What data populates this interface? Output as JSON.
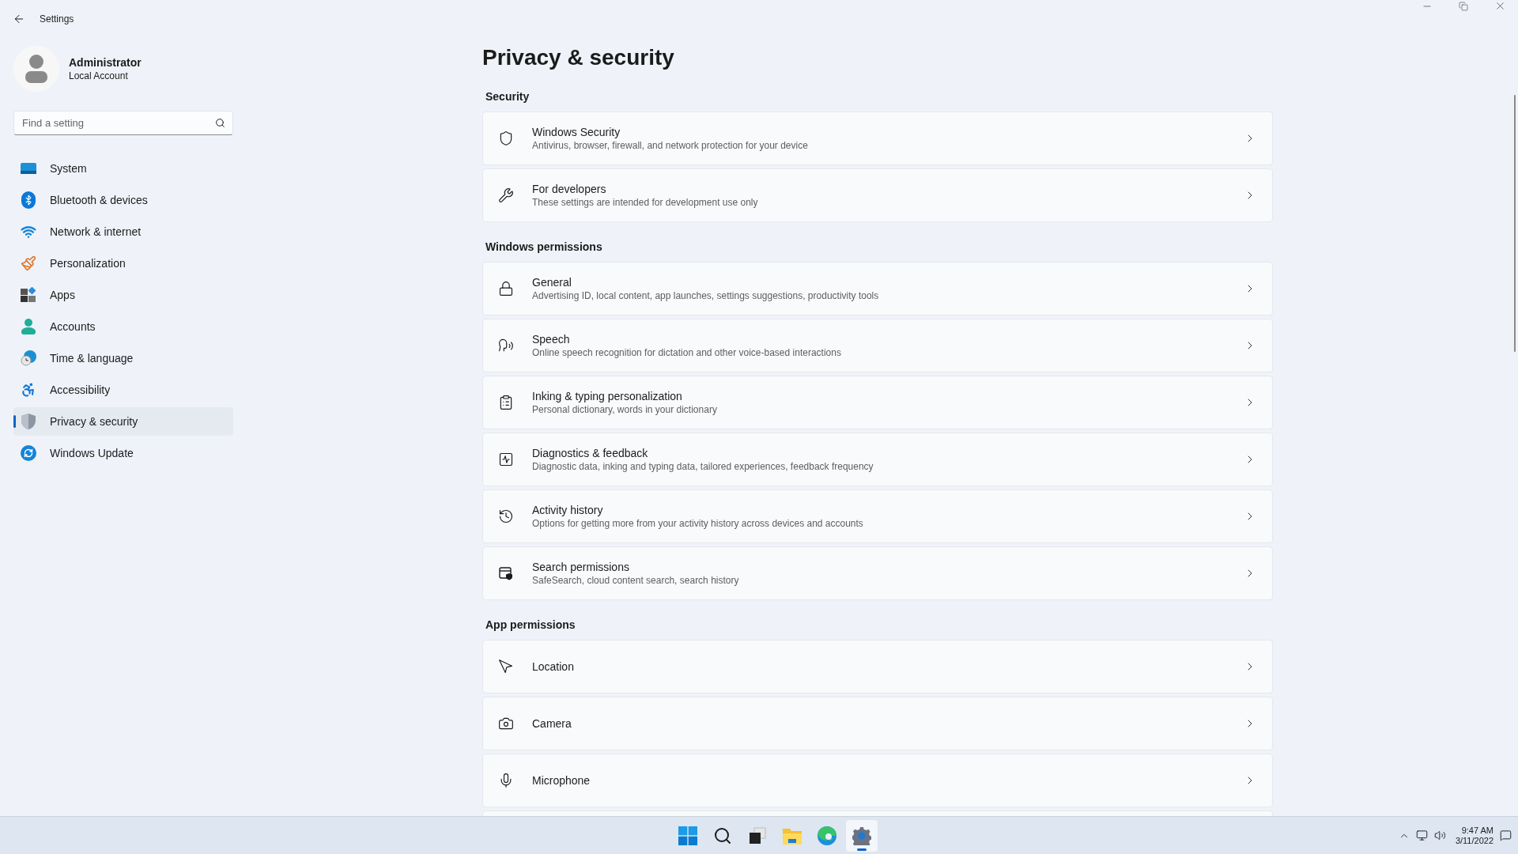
{
  "window": {
    "title": "Settings"
  },
  "user": {
    "name": "Administrator",
    "account": "Local Account"
  },
  "search": {
    "placeholder": "Find a setting"
  },
  "nav": [
    {
      "label": "System",
      "kind": "system",
      "selected": false
    },
    {
      "label": "Bluetooth & devices",
      "kind": "bluetooth",
      "selected": false
    },
    {
      "label": "Network & internet",
      "kind": "wifi",
      "selected": false
    },
    {
      "label": "Personalization",
      "kind": "brush",
      "selected": false
    },
    {
      "label": "Apps",
      "kind": "apps",
      "selected": false
    },
    {
      "label": "Accounts",
      "kind": "person",
      "selected": false
    },
    {
      "label": "Time & language",
      "kind": "globe",
      "selected": false
    },
    {
      "label": "Accessibility",
      "kind": "accessibility",
      "selected": false
    },
    {
      "label": "Privacy & security",
      "kind": "shield",
      "selected": true
    },
    {
      "label": "Windows Update",
      "kind": "update",
      "selected": false
    }
  ],
  "page_title": "Privacy & security",
  "sections": [
    {
      "heading": "Security",
      "items": [
        {
          "kind": "shield",
          "title": "Windows Security",
          "subtitle": "Antivirus, browser, firewall, and network protection for your device"
        },
        {
          "kind": "tools",
          "title": "For developers",
          "subtitle": "These settings are intended for development use only"
        }
      ]
    },
    {
      "heading": "Windows permissions",
      "items": [
        {
          "kind": "lock",
          "title": "General",
          "subtitle": "Advertising ID, local content, app launches, settings suggestions, productivity tools"
        },
        {
          "kind": "speech",
          "title": "Speech",
          "subtitle": "Online speech recognition for dictation and other voice-based interactions"
        },
        {
          "kind": "clipboard",
          "title": "Inking & typing personalization",
          "subtitle": "Personal dictionary, words in your dictionary"
        },
        {
          "kind": "pulse",
          "title": "Diagnostics & feedback",
          "subtitle": "Diagnostic data, inking and typing data, tailored experiences, feedback frequency"
        },
        {
          "kind": "history",
          "title": "Activity history",
          "subtitle": "Options for getting more from your activity history across devices and accounts"
        },
        {
          "kind": "searchshield",
          "title": "Search permissions",
          "subtitle": "SafeSearch, cloud content search, search history"
        }
      ]
    },
    {
      "heading": "App permissions",
      "items": [
        {
          "kind": "location",
          "title": "Location"
        },
        {
          "kind": "camera",
          "title": "Camera"
        },
        {
          "kind": "mic",
          "title": "Microphone"
        }
      ]
    }
  ],
  "taskbar": {
    "apps": [
      {
        "kind": "start",
        "selected": false
      },
      {
        "kind": "search",
        "selected": false
      },
      {
        "kind": "taskview",
        "selected": false
      },
      {
        "kind": "explorer",
        "selected": false
      },
      {
        "kind": "browser",
        "selected": false
      },
      {
        "kind": "settings",
        "selected": true
      }
    ],
    "time": "9:47 AM",
    "date": "3/11/2022"
  }
}
